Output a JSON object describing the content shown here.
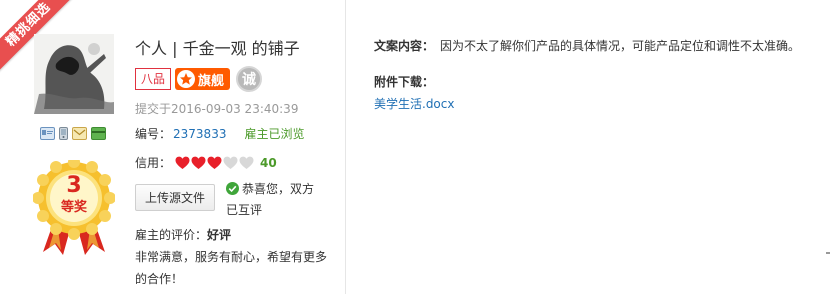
{
  "ribbon": {
    "text": "精挑细选"
  },
  "shop": {
    "title": "个人 | 千金一观 的铺子",
    "level_badge": "八品",
    "flag_badge": "旗舰",
    "integrity_badge": "诚"
  },
  "medal": {
    "rank": "3",
    "label": "等奖"
  },
  "submission": {
    "time": "提交于2016-09-03 23:40:39",
    "order_label": "编号：",
    "order_no": "2373833",
    "viewed_status": "雇主已浏览"
  },
  "credit": {
    "label": "信用：",
    "hearts_filled": 3,
    "hearts_total": 5,
    "score": "40",
    "colors": {
      "filled": "#e8202a",
      "empty": "#d8d8d8"
    }
  },
  "actions": {
    "upload_label": "上传源文件"
  },
  "mutual": {
    "text": "恭喜您，双方已互评"
  },
  "review": {
    "label": "雇主的评价：",
    "rating": "好评",
    "text": "非常满意，服务有耐心，希望有更多的合作！"
  },
  "detail": {
    "content_label": "文案内容：",
    "content_value": "因为不太了解你们产品的具体情况，可能产品定位和调性不太准确。",
    "attachment_label": "附件下载：",
    "attachment_file": "美学生活.docx"
  },
  "icons": [
    "id-card-icon",
    "phone-icon",
    "email-icon",
    "bank-card-icon",
    "star-icon",
    "check-circle-icon",
    "heart-icon",
    "medal-icon"
  ],
  "colors": {
    "accent_red": "#e84f4f",
    "link_blue": "#1f6fb4",
    "green": "#4c9a2a",
    "flag_orange": "#ff5a00"
  }
}
